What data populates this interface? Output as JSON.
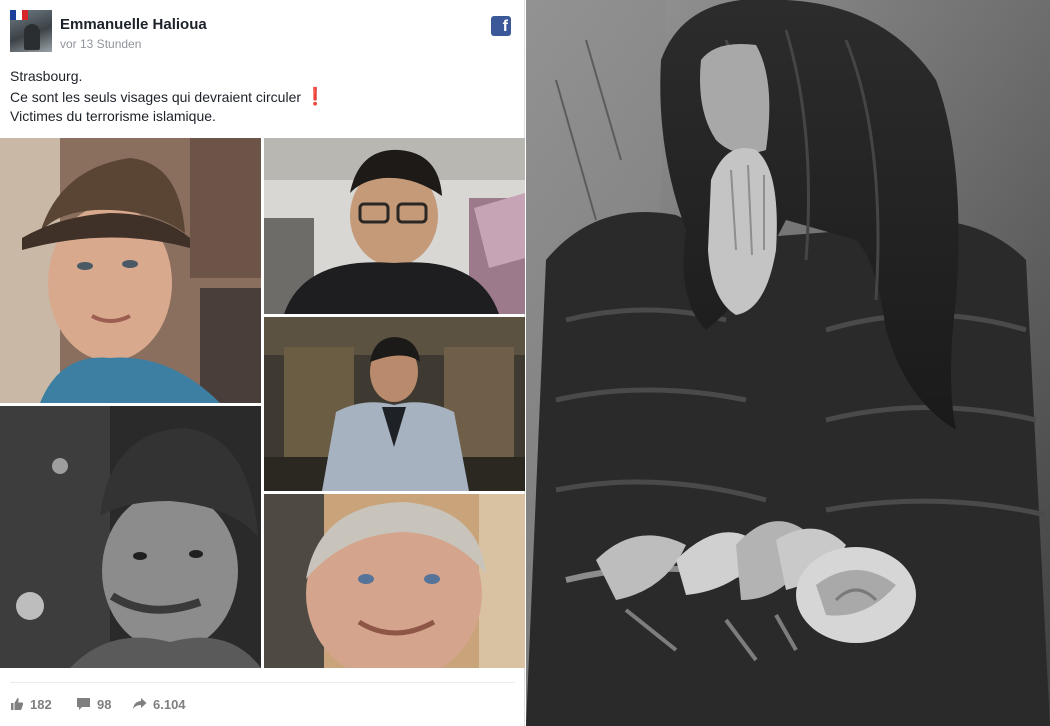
{
  "post": {
    "author": "Emmanuelle Halioua",
    "timestamp": "vor 13 Stunden",
    "lines": [
      "Strasbourg.",
      "Ce sont les seuls visages qui devraient circuler",
      "Victimes du terrorisme islamique."
    ],
    "exclamation": "❗",
    "reactions": "182",
    "comments": "98",
    "shares": "6.104"
  },
  "icons": {
    "brand": "facebook-icon",
    "like": "thumbs-up-icon",
    "comment": "speech-bubble-icon",
    "share": "share-arrow-icon"
  },
  "colors": {
    "facebook_blue": "#3b5998",
    "text": "#1d2129",
    "muted": "#90949c",
    "stat": "#7f7f7f",
    "exclamation": "#e02020"
  }
}
